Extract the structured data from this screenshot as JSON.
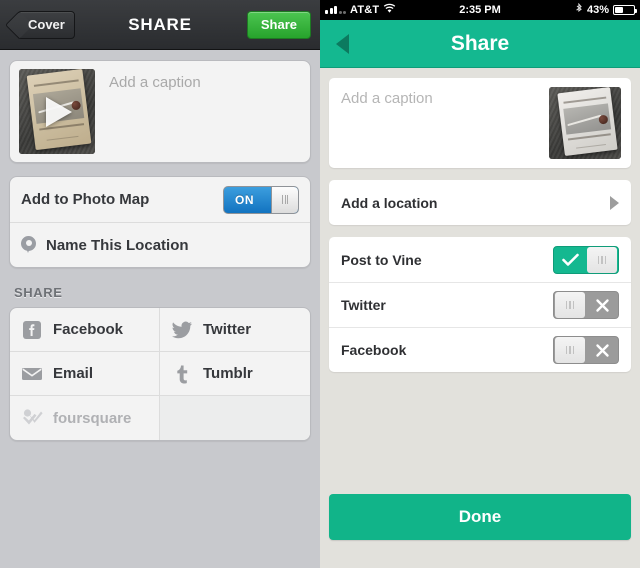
{
  "left_panel": {
    "nav": {
      "back_label": "Cover",
      "title": "SHARE",
      "share_label": "Share"
    },
    "caption": {
      "placeholder": "Add a caption",
      "thumbnail_icon": "video-thumbnail-with-play-overlay"
    },
    "photo_map": {
      "label": "Add to Photo Map",
      "toggle_state": "ON"
    },
    "location": {
      "label": "Name This Location",
      "icon": "map-pin-icon"
    },
    "share_section": {
      "header": "SHARE",
      "services": [
        {
          "label": "Facebook",
          "icon": "facebook-icon",
          "disabled": false
        },
        {
          "label": "Twitter",
          "icon": "twitter-bird-icon",
          "disabled": false
        },
        {
          "label": "Email",
          "icon": "envelope-icon",
          "disabled": false
        },
        {
          "label": "Tumblr",
          "icon": "tumblr-icon",
          "disabled": false
        },
        {
          "label": "foursquare",
          "icon": "foursquare-icon",
          "disabled": true
        }
      ]
    }
  },
  "right_panel": {
    "statusbar": {
      "carrier": "AT&T",
      "time": "2:35 PM",
      "battery_percent": "43%",
      "wifi_icon": "wifi-icon",
      "bluetooth_icon": "bluetooth-icon",
      "signal_icon": "signal-strength-icon",
      "battery_icon": "battery-icon"
    },
    "nav": {
      "title": "Share",
      "back_icon": "back-triangle-icon"
    },
    "caption": {
      "placeholder": "Add a caption",
      "thumbnail_icon": "video-thumbnail"
    },
    "location": {
      "label": "Add a location",
      "chevron_icon": "chevron-right-icon"
    },
    "toggles": [
      {
        "label": "Post to Vine",
        "state": "on",
        "mark_icon": "checkmark-icon"
      },
      {
        "label": "Twitter",
        "state": "off",
        "mark_icon": "cross-icon"
      },
      {
        "label": "Facebook",
        "state": "off",
        "mark_icon": "cross-icon"
      }
    ],
    "done_label": "Done"
  },
  "colors": {
    "vine_green": "#14b890",
    "done_green": "#11b489",
    "ios_blue": "#1273c0",
    "share_button_green": "#27a32c",
    "left_bg": "#c8c9cd",
    "right_bg": "#e2e1dc"
  }
}
